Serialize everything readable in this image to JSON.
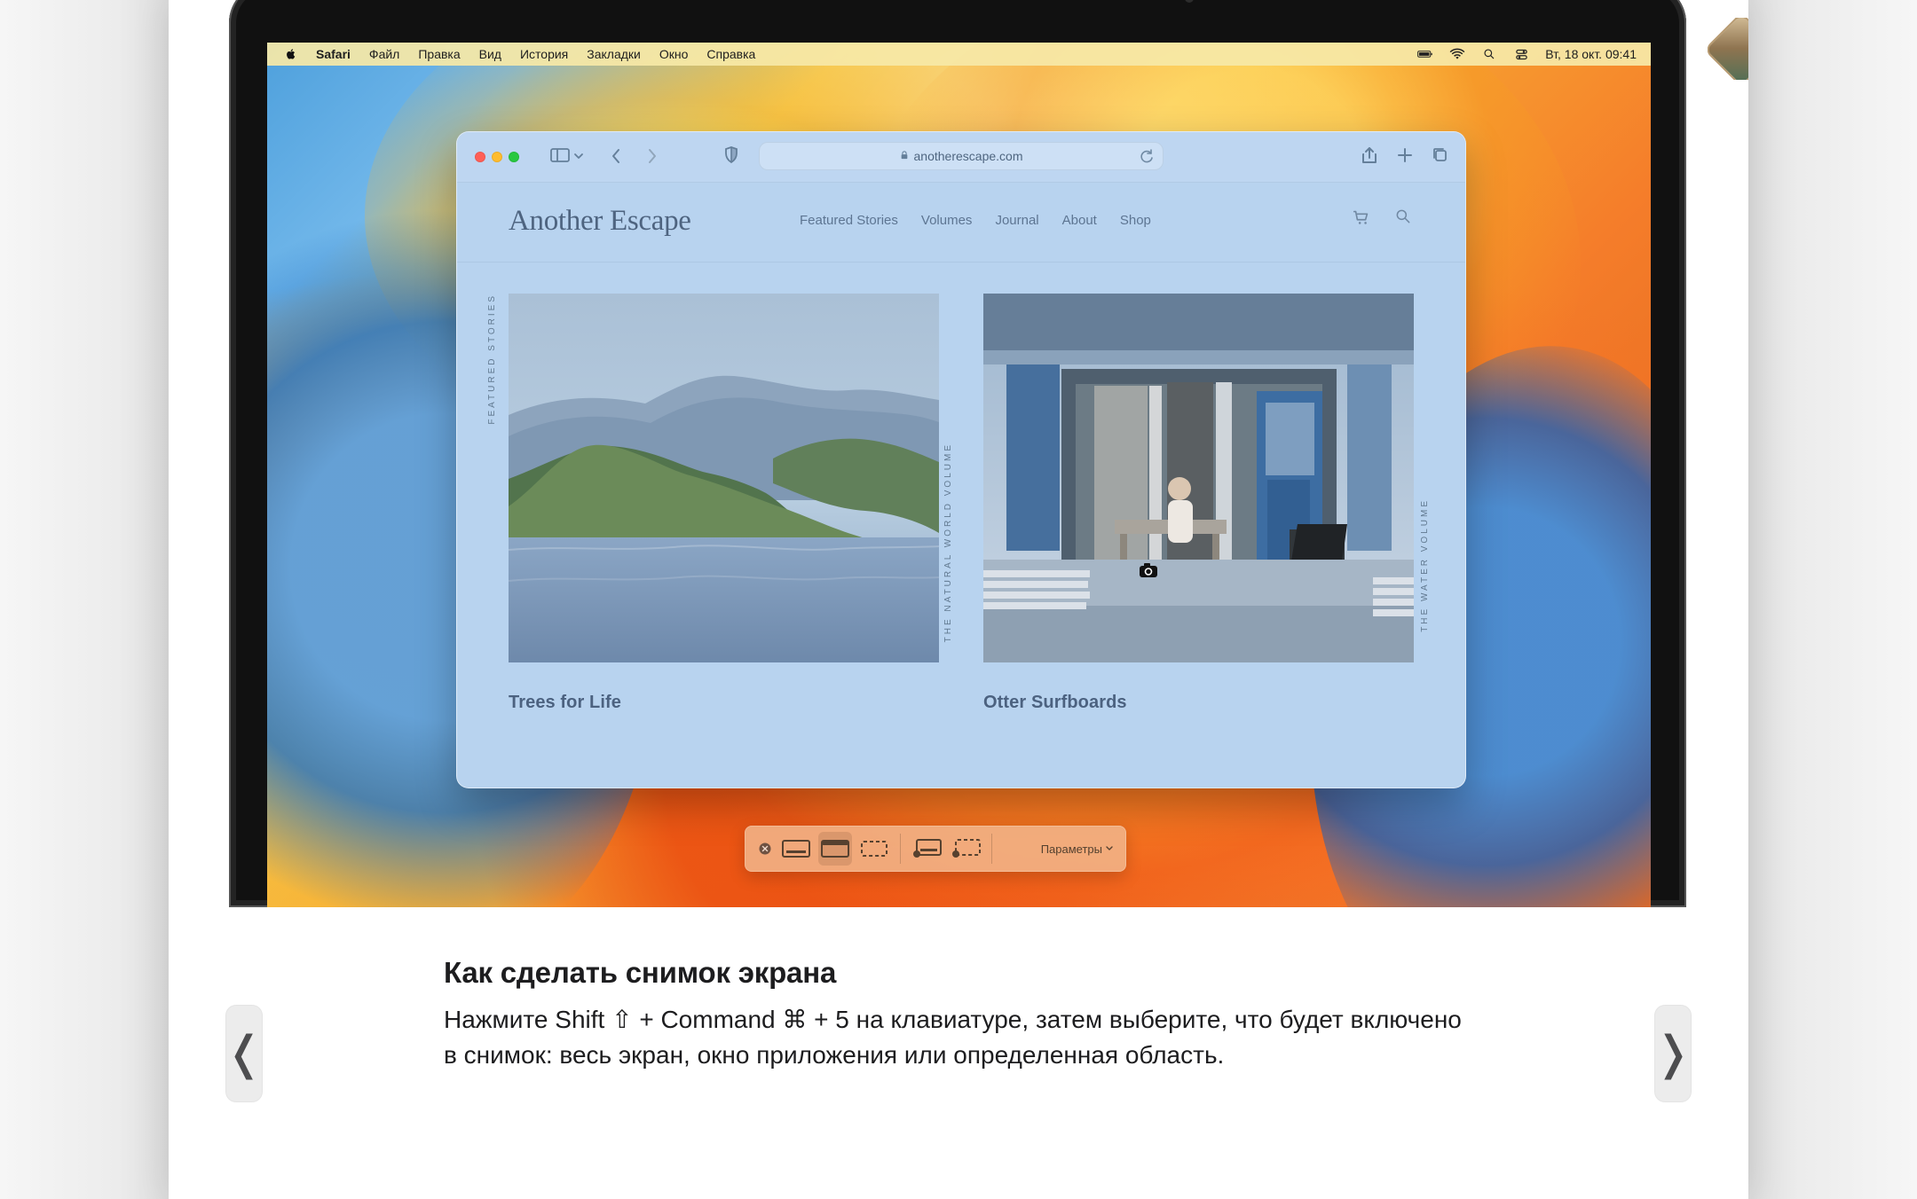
{
  "menu_bar": {
    "app_name": "Safari",
    "items": [
      "Файл",
      "Правка",
      "Вид",
      "История",
      "Закладки",
      "Окно",
      "Справка"
    ],
    "status": {
      "datetime": "Вт, 18 окт. 09:41",
      "icons": [
        "battery-icon",
        "wifi-icon",
        "search-icon",
        "control-center-icon"
      ]
    }
  },
  "browser": {
    "url": "anotherescape.com",
    "toolbar_icons": [
      "sidebar-icon",
      "back-icon",
      "forward-icon",
      "shield-icon",
      "share-icon",
      "new-tab-icon",
      "tabs-icon"
    ],
    "site": {
      "logo": "Another Escape",
      "nav": [
        "Featured Stories",
        "Volumes",
        "Journal",
        "About",
        "Shop"
      ],
      "labels": {
        "featured": "FEATURED STORIES",
        "natural": "THE NATURAL WORLD VOLUME",
        "water": "THE WATER VOLUME"
      },
      "stories": [
        {
          "title": "Trees for Life"
        },
        {
          "title": "Otter Surfboards"
        }
      ]
    }
  },
  "screenshot_bar": {
    "params_label": "Параметры"
  },
  "caption": {
    "title": "Как сделать снимок экрана",
    "body": "Нажмите Shift ⇧ + Command ⌘ + 5 на клавиатуре, затем выберите, что будет включено в снимок: весь экран, окно приложения или определенная область."
  },
  "navigation": {
    "prev": "❬",
    "next": "❭"
  },
  "colors": {
    "browser_tint": "#b8d3ef",
    "menu_bar": "#f6e8a7",
    "screenshot_bar": "#f1b489"
  }
}
